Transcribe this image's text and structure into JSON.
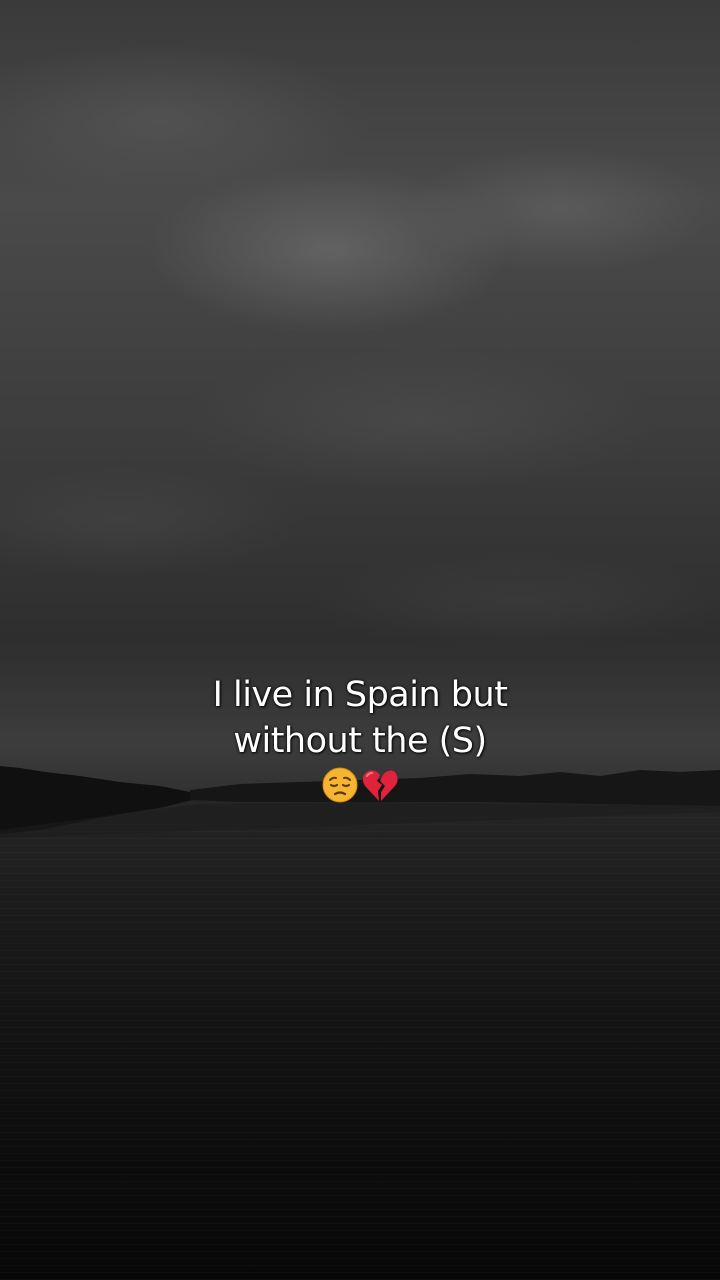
{
  "caption": {
    "line1": "I live in Spain but",
    "line2": "without the (S)"
  },
  "emojis": [
    "pensive-face-emoji",
    "broken-heart-emoji"
  ],
  "colors": {
    "caption_text": "#ffffff",
    "emoji_face": "#f5b530",
    "emoji_heart": "#e0233a"
  }
}
